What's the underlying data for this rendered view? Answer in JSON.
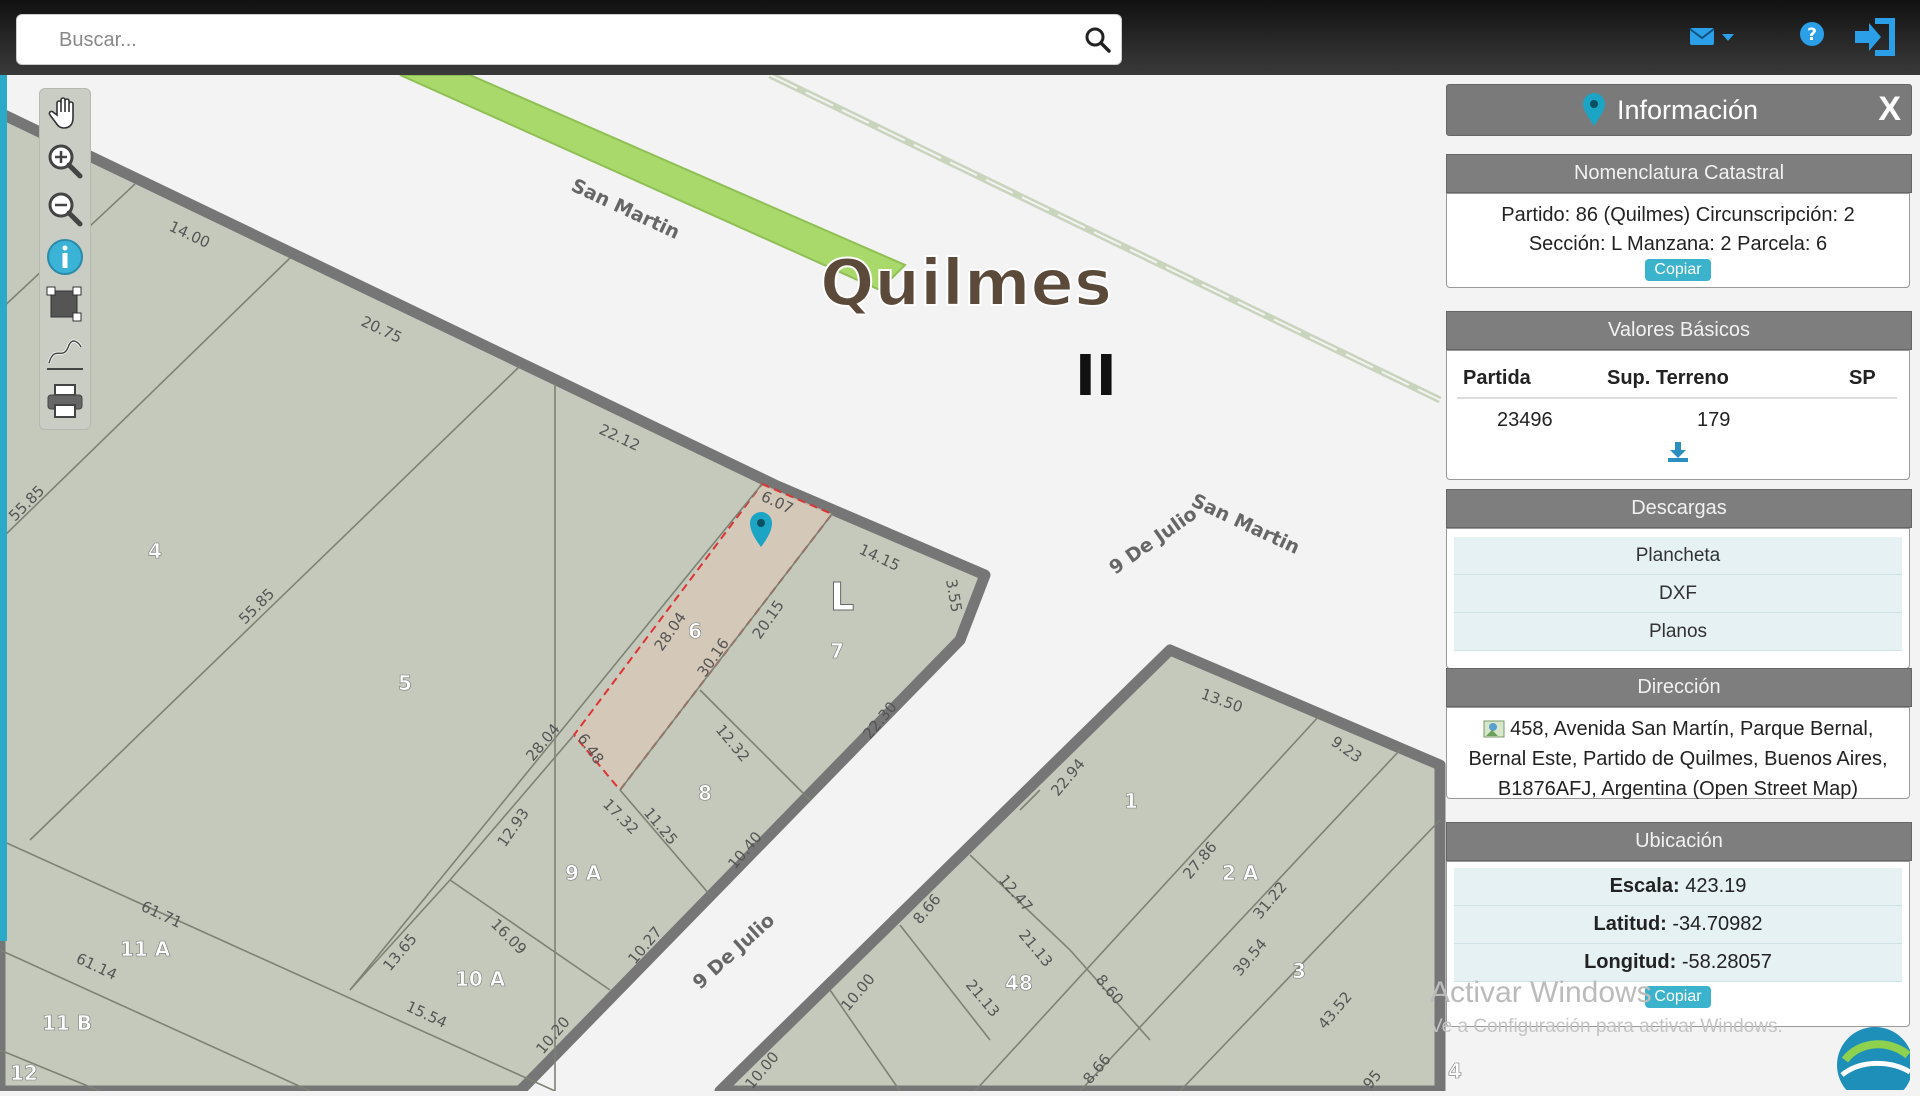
{
  "search": {
    "placeholder": "Buscar..."
  },
  "topbar": {
    "mail_icon": "envelope-icon",
    "help_icon": "question-circle-icon",
    "logout_icon": "sign-out-icon"
  },
  "toolbar": {
    "tools": [
      "pan-hand-icon",
      "zoom-in-icon",
      "zoom-out-icon",
      "info-icon",
      "select-area-icon",
      "measure-icon",
      "print-icon"
    ]
  },
  "map": {
    "city_label": "Quilmes",
    "block_label": "L",
    "roman": "II",
    "streets": [
      "San Martin",
      "9 De Julio San Martin",
      "9 De Julio"
    ],
    "parcels": [
      "4",
      "5",
      "6",
      "7",
      "8",
      "9 A",
      "10 A",
      "11 A",
      "11 B",
      "12",
      "1",
      "2 A",
      "3",
      "4",
      "48"
    ],
    "dims": [
      "14.00",
      "20.75",
      "22.12",
      "55.85",
      "55.85",
      "6.07",
      "14.15",
      "3.55",
      "28.04",
      "30.16",
      "20.15",
      "22.30",
      "28.04",
      "6.48",
      "12.32",
      "12.93",
      "17.32",
      "11.25",
      "10.40",
      "16.09",
      "13.65",
      "10.27",
      "15.54",
      "10.20",
      "61.71",
      "61.14",
      "13.50",
      "9.23",
      "22.94",
      "27.86",
      "31.22",
      "12.47",
      "8.66",
      "21.13",
      "8.60",
      "39.54",
      "43.52",
      "10.00",
      "21.13",
      "8.66",
      "10.00",
      "95"
    ]
  },
  "panel": {
    "title": "Información",
    "close": "X",
    "nomenclatura": {
      "title": "Nomenclatura Catastral",
      "line1": "Partido: 86 (Quilmes) Circunscripción: 2",
      "line2": "Sección: L Manzana: 2 Parcela: 6",
      "copy": "Copiar"
    },
    "valores": {
      "title": "Valores Básicos",
      "headers": [
        "Partida",
        "Sup. Terreno",
        "SP"
      ],
      "partida": "23496",
      "sup": "179",
      "sp": "",
      "download_icon": "download-icon"
    },
    "descargas": {
      "title": "Descargas",
      "items": [
        "Plancheta",
        "DXF",
        "Planos"
      ]
    },
    "direccion": {
      "title": "Dirección",
      "text": "458, Avenida San Martín, Parque Bernal, Bernal Este, Partido de Quilmes, Buenos Aires, B1876AFJ, Argentina (Open Street Map)"
    },
    "ubicacion": {
      "title": "Ubicación",
      "escala_label": "Escala:",
      "escala": "423.19",
      "lat_label": "Latitud:",
      "lat": "-34.70982",
      "lon_label": "Longitud:",
      "lon": "-58.28057",
      "copy": "Copiar"
    }
  },
  "watermark": {
    "line1": "Activar Windows",
    "line2": "Ve a Configuración para activar Windows."
  }
}
